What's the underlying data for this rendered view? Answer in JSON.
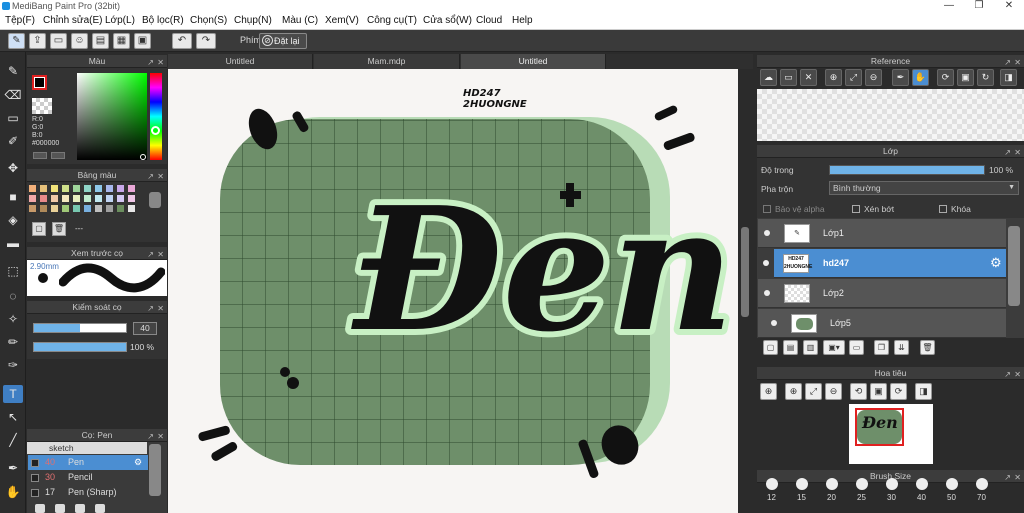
{
  "window": {
    "title": "MediBang Paint Pro (32bit)",
    "minimize": "—",
    "maximize": "❐",
    "close": "✕"
  },
  "menu": [
    "Tệp(F)",
    "Chỉnh sửa(E)",
    "Lớp(L)",
    "Bộ lọc(R)",
    "Chọn(S)",
    "Chụp(N)",
    "Màu (C)",
    "Xem(V)",
    "Công cụ(T)",
    "Cửa sổ(W)",
    "Cloud",
    "Help"
  ],
  "toolbar": {
    "keys_label": "Phím",
    "reset_label": "Đặt lại"
  },
  "tabs": [
    "Untitled",
    "Mam.mdp",
    "Untitled"
  ],
  "color_panel": {
    "title": "Màu",
    "r": "R:0",
    "g": "G:0",
    "b": "B:0",
    "hex": "#000000",
    "main_color": "#000000"
  },
  "palette_panel": {
    "title": "Bảng màu",
    "footer": "---",
    "colors": [
      "#f3b07a",
      "#e6c07a",
      "#f2e37a",
      "#cfe08a",
      "#9ed59a",
      "#8fd5c8",
      "#8ec8ea",
      "#a8b8ee",
      "#c8a8ea",
      "#eaa8d8",
      "#f2a8a8",
      "#e88a8a",
      "#f0c8a8",
      "#f5e8c0",
      "#e8f0c0",
      "#c0ecd0",
      "#c0e8f0",
      "#c0d4f4",
      "#d4c8f4",
      "#f0c8e8",
      "#c89a6a",
      "#b08a5a",
      "#e8d098",
      "#a0c878",
      "#78c8b0",
      "#78b0e0",
      "#c0c0c0",
      "#a0a0a0",
      "#6b8e5e",
      "#e8e8e8"
    ]
  },
  "preview_panel": {
    "title": "Xem trước cọ",
    "size": "2.90mm"
  },
  "control_panel": {
    "title": "Kiểm soát cọ",
    "size_value": "40",
    "opacity_value": "100 %",
    "size_fraction": 0.5,
    "opacity_fraction": 1.0
  },
  "brush_panel": {
    "title": "Cọ: Pen",
    "group": "sketch",
    "items": [
      {
        "size": "40",
        "name": "Pen"
      },
      {
        "size": "30",
        "name": "Pencil"
      },
      {
        "size": "17",
        "name": "Pen (Sharp)"
      }
    ]
  },
  "canvas": {
    "watermark_line1": "HD247",
    "watermark_line2": "2HUONGNE",
    "art_text": "Đen",
    "grid_color": "#2e4a2e",
    "blob_color": "#6e8f6a",
    "shadow_color": "#b8dcb6",
    "ink_color": "#111111"
  },
  "reference_panel": {
    "title": "Reference"
  },
  "layer_panel": {
    "title": "Lớp",
    "opacity_label": "Độ trong",
    "opacity_value": "100 %",
    "opacity_fraction": 1.0,
    "blend_label": "Pha trộn",
    "blend_value": "Bình thường",
    "protect_alpha": "Bảo vệ alpha",
    "clipping": "Xén bớt",
    "lock": "Khóa",
    "layers": [
      {
        "name": "Lớp1"
      },
      {
        "name": "hd247"
      },
      {
        "name": "Lớp2"
      },
      {
        "name": "Lớp5"
      }
    ]
  },
  "navigator_panel": {
    "title": "Hoa tiêu",
    "thumb_text": "Đen"
  },
  "brush_size_panel": {
    "title": "Brush Size",
    "sizes": [
      "12",
      "15",
      "20",
      "25",
      "30",
      "40",
      "50",
      "70"
    ]
  }
}
